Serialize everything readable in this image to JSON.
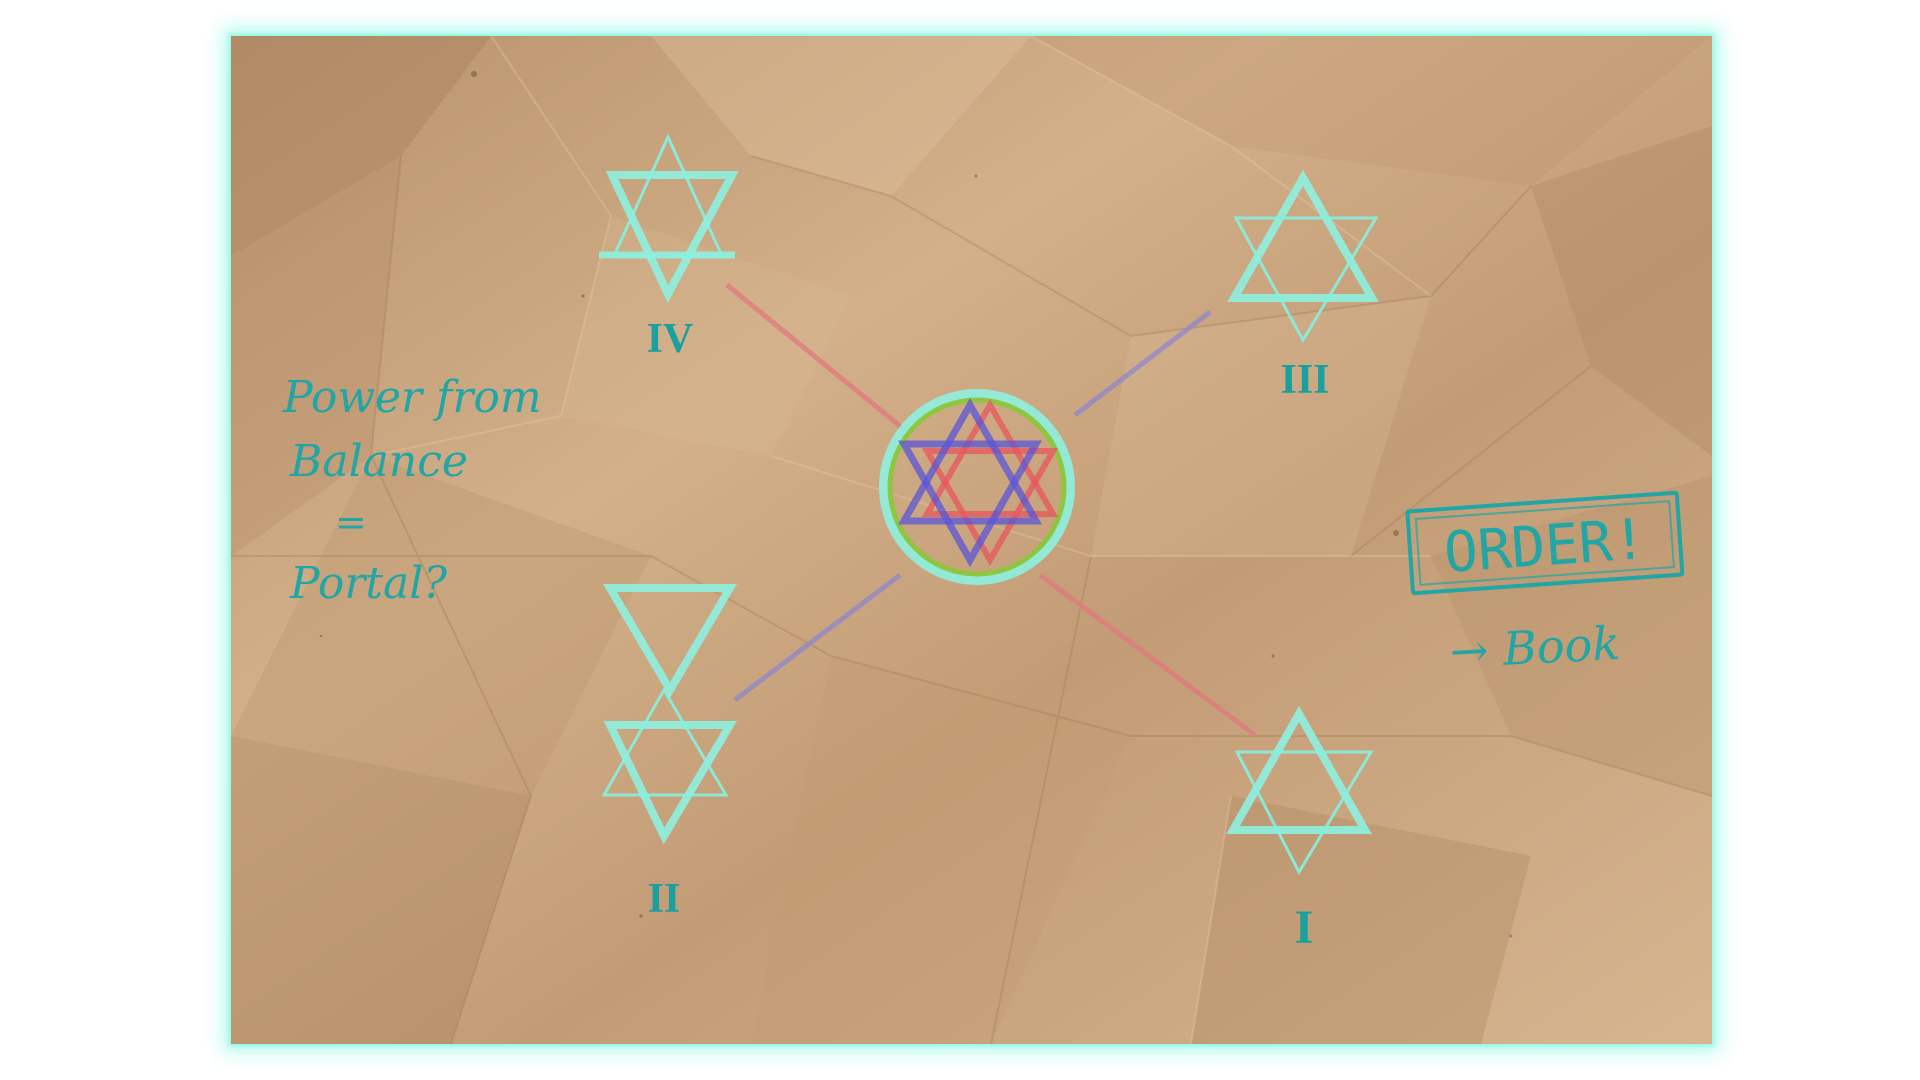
{
  "scene": {
    "note_lines": [
      "Power from",
      "Balance",
      "=",
      "Portal?"
    ],
    "stamp_text": "ORDER!",
    "stamp_subtext": "→ Book",
    "numerals": {
      "top_left": "IV",
      "top_right": "III",
      "bottom_left": "II",
      "bottom_right": "I"
    }
  },
  "colors": {
    "paper": "#c9a57f",
    "glow": "#7ff5e1",
    "ink_teal": "#21a5a5",
    "star_cyan": "#8ef0e0",
    "line_red": "#e2787e",
    "line_violet": "#8b86d0",
    "ring_green": "#8cc63c",
    "center_blue": "#5a55d8",
    "center_red": "#e8565e"
  }
}
